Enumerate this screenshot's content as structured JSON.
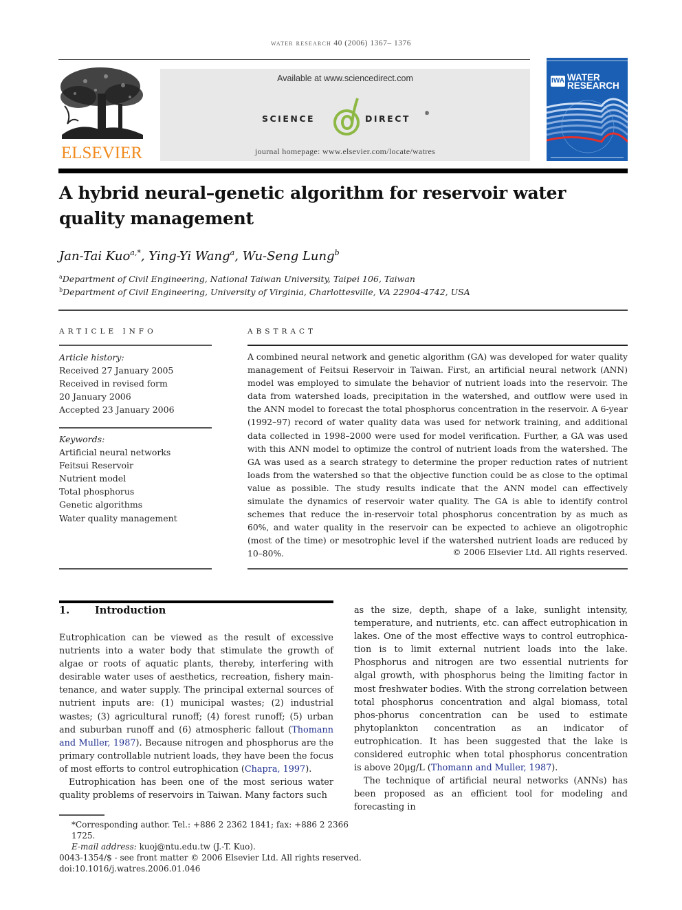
{
  "running_header": {
    "journal_smallcaps": "water research",
    "citation": "40 (2006) 1367– 1376"
  },
  "publisher": {
    "logo_word": "ELSEVIER",
    "logo_color": "#f08a1e"
  },
  "sciencedirect": {
    "available": "Available at www.sciencedirect.com",
    "word_left": "SCIENCE",
    "word_at": "@",
    "word_right": "DIRECT",
    "registered": "®",
    "homepage": "journal homepage: www.elsevier.com/locate/watres",
    "accent_color": "#8db843"
  },
  "cover": {
    "badge": "IWA",
    "title_line1": "WATER",
    "title_line2": "RESEARCH",
    "color": "#1a5fb4"
  },
  "article": {
    "title_line1": "A hybrid neural–genetic algorithm for reservoir water",
    "title_line2": "quality management",
    "authors": [
      {
        "name": "Jan-Tai Kuo",
        "sup": "a,*"
      },
      {
        "name": "Ying-Yi Wang",
        "sup": "a"
      },
      {
        "name": "Wu-Seng Lung",
        "sup": "b"
      }
    ],
    "author_separator": ", ",
    "affiliations": [
      {
        "sup": "a",
        "text": "Department of Civil Engineering, National Taiwan University, Taipei 106, Taiwan"
      },
      {
        "sup": "b",
        "text": "Department of Civil Engineering, University of Virginia, Charlottesville, VA 22904-4742, USA"
      }
    ]
  },
  "article_info": {
    "heading": "ARTICLE INFO",
    "history_label": "Article history:",
    "history": [
      "Received 27 January 2005",
      "Received in revised form",
      "20 January 2006",
      "Accepted 23 January 2006"
    ],
    "keywords_label": "Keywords:",
    "keywords": [
      "Artificial neural networks",
      "Feitsui Reservoir",
      "Nutrient model",
      "Total phosphorus",
      "Genetic algorithms",
      "Water quality management"
    ]
  },
  "abstract": {
    "heading": "ABSTRACT",
    "text": "A combined neural network and genetic algorithm (GA) was developed for water quality management of Feitsui Reservoir in Taiwan. First, an artificial neural network (ANN) model was employed to simulate the behavior of nutrient loads into the reservoir. The data from watershed loads, precipitation in the watershed, and outflow were used in the ANN model to forecast the total phosphorus concentration in the reservoir. A 6-year (1992–97) record of water quality data was used for network training, and additional data collected in 1998–2000 were used for model verification. Further, a GA was used with this ANN model to optimize the control of nutrient loads from the watershed. The GA was used as a search strategy to determine the proper reduction rates of nutrient loads from the watershed so that the objective function could be as close to the optimal value as possible. The study results indicate that the ANN model can effectively simulate the dynamics of reservoir water quality. The GA is able to identify control schemes that reduce the in-reservoir total phosphorus concentration by as much as 60%, and water quality in the reservoir can be expected to achieve an oligotrophic (most of the time) or mesotrophic level if the watershed nutrient loads are reduced by 10–80%.",
    "copyright": "© 2006 Elsevier Ltd. All rights reserved."
  },
  "introduction": {
    "number": "1.",
    "heading": "Introduction",
    "p1_a": "Eutrophication can be viewed as the result of excessive nutrients into a water body that stimulate the growth of algae or roots of aquatic plants, thereby, interfering with desirable water uses of aesthetics, recreation, fishery main-tenance, and water supply. The principal external sources of nutrient inputs are: (1) municipal wastes; (2) industrial wastes; (3) agricultural runoff; (4) forest runoff; (5) urban and suburban runoff and (6) atmospheric fallout (",
    "p1_cite1": "Thomann and Muller, 1987",
    "p1_b": "). Because nitrogen and phosphorus are the primary controllable nutrient loads, they have been the focus of most efforts to control eutrophication (",
    "p1_cite2": "Chapra, 1997",
    "p1_c": ").",
    "p2_a": "Eutrophication has been one of the most serious water quality problems of reservoirs in Taiwan. Many factors such as the size, depth, shape of a lake, sunlight intensity, temperature, and nutrients, etc. can affect eutrophication in lakes. One of the most effective ways to control eutrophica-tion is to limit external nutrient loads into the lake. Phosphorus and nitrogen are two essential nutrients for algal growth, with phosphorus being the limiting factor in most freshwater bodies. With the strong correlation between total phosphorus concentration and algal biomass, total phos-phorus concentration can be used to estimate phytoplankton concentration as an indicator of eutrophication. It has been suggested that the lake is considered eutrophic when total phosphorus concentration is above 20µg/L (",
    "p2_cite": "Thomann and Muller, 1987",
    "p2_b": ").",
    "p3": "The technique of artificial neural networks (ANNs) has been proposed as an efficient tool for modeling and forecasting in"
  },
  "footnotes": {
    "corresponding": "*Corresponding author. Tel.: +886 2 2362 1841; fax: +886 2 2366 1725.",
    "email_label": "E-mail address:",
    "email": " kuoj@ntu.edu.tw (J.-T. Kuo).",
    "issn": "0043-1354/$ - see front matter © 2006 Elsevier Ltd. All rights reserved.",
    "doi": "doi:10.1016/j.watres.2006.01.046"
  }
}
